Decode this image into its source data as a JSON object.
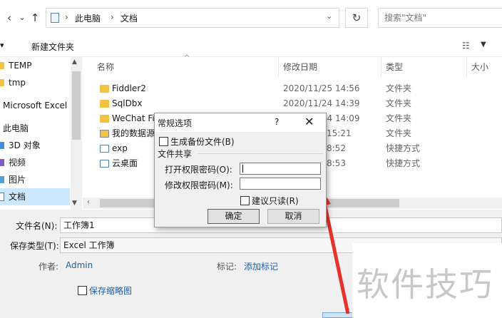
{
  "address": {
    "crumbs": [
      "此电脑",
      "文档"
    ],
    "search_placeholder": "搜索\"文档\""
  },
  "toolbar": {
    "new_folder": "新建文件夹"
  },
  "sidebar": {
    "items": [
      {
        "label": "TEMP",
        "icon": "folder-icon"
      },
      {
        "label": "tmp",
        "icon": "folder-icon"
      },
      {
        "label": "Microsoft Excel",
        "icon": "none"
      },
      {
        "label": "此电脑",
        "icon": "none"
      },
      {
        "label": "3D 对象",
        "icon": "cube-icon"
      },
      {
        "label": "视频",
        "icon": "video-icon"
      },
      {
        "label": "图片",
        "icon": "picture-icon"
      },
      {
        "label": "文档",
        "icon": "document-icon",
        "selected": true
      }
    ]
  },
  "columns": {
    "name": "名称",
    "date": "修改日期",
    "type": "类型",
    "size": "大小"
  },
  "files": [
    {
      "name": "Fiddler2",
      "date": "2020/11/25 14:56",
      "type": "文件夹",
      "icon": "folder-icon"
    },
    {
      "name": "SqlDbx",
      "date": "2020/11/24 14:39",
      "type": "文件夹",
      "icon": "folder-icon"
    },
    {
      "name": "WeChat Fi",
      "date": "2020/11/24 14:09",
      "type": "文件夹",
      "icon": "folder-icon"
    },
    {
      "name": "我的数据源",
      "date": "15:21",
      "type": "文件夹",
      "icon": "datasource-folder-icon"
    },
    {
      "name": "exp",
      "date": "8:52",
      "type": "快捷方式",
      "icon": "shortcut-icon"
    },
    {
      "name": "云桌面",
      "date": "8:53",
      "type": "快捷方式",
      "icon": "shortcut-icon"
    }
  ],
  "bottom": {
    "filename_label": "文件名(N):",
    "filename_value": "工作簿1",
    "filetype_label": "保存类型(T):",
    "filetype_value": "Excel 工作簿",
    "author_label": "作者:",
    "author_value": "Admin",
    "tags_label": "标记:",
    "tags_value": "添加标记",
    "thumbnail_label": "保存缩略图"
  },
  "dialog": {
    "title": "常规选项",
    "help": "?",
    "backup_label": "生成备份文件(B)",
    "share_group": "文件共享",
    "open_pwd_label": "打开权限密码(O):",
    "open_pwd_value": "",
    "modify_pwd_label": "修改权限密码(M):",
    "modify_pwd_value": "",
    "readonly_label": "建议只读(R)",
    "ok": "确定",
    "cancel": "取消"
  },
  "watermark": {
    "text": "软件技巧"
  },
  "colors": {
    "folder": "#f3c242",
    "link": "#1f5fa8",
    "selected": "#cce8ff",
    "arrow": "#e8312a"
  }
}
